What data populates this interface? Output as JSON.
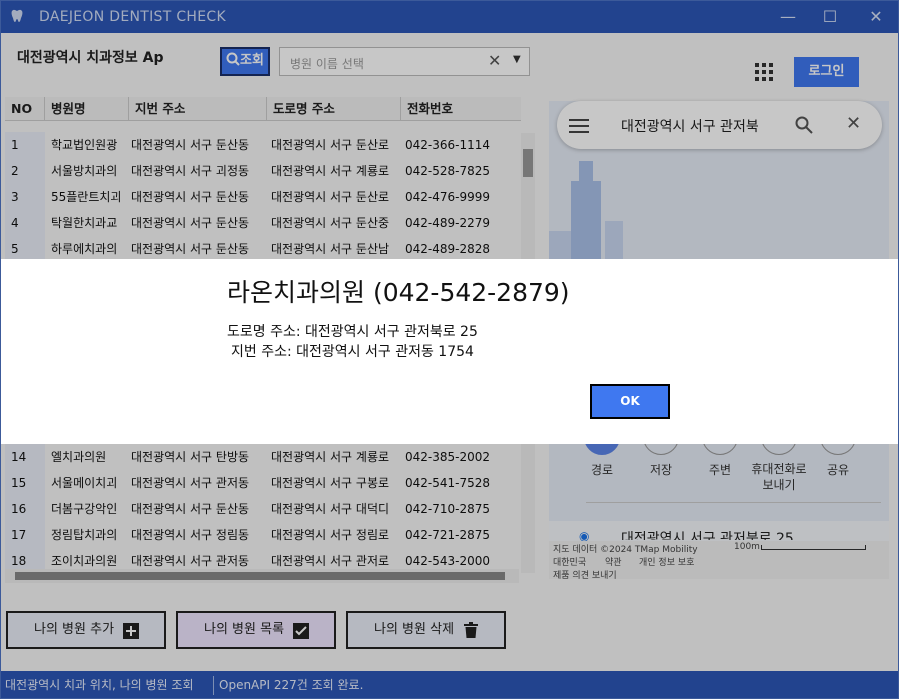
{
  "window": {
    "title": "DAEJEON DENTIST CHECK"
  },
  "header": {
    "title": "대전광역시 치과정보 Ap",
    "search_button": "조회",
    "combo_placeholder": "병원 이름 선택",
    "login_button": "로그인"
  },
  "table": {
    "headers": [
      "NO",
      "병원명",
      "지번 주소",
      "도로명 주소",
      "전화번호"
    ],
    "rows_top": [
      {
        "no": "1",
        "name": "학교법인원광",
        "jibun": "대전광역시 서구 둔산동",
        "road": "대전광역시 서구 둔산로",
        "phone": "042-366-1114"
      },
      {
        "no": "2",
        "name": "서울방치과의",
        "jibun": "대전광역시 서구 괴정동",
        "road": "대전광역시 서구 계룡로",
        "phone": "042-528-7825"
      },
      {
        "no": "3",
        "name": "55플란트치괴",
        "jibun": "대전광역시 서구 둔산동",
        "road": "대전광역시 서구 둔산로",
        "phone": "042-476-9999"
      },
      {
        "no": "4",
        "name": "탁월한치과교",
        "jibun": "대전광역시 서구 둔산동",
        "road": "대전광역시 서구 둔산중",
        "phone": "042-489-2279"
      },
      {
        "no": "5",
        "name": "하루에치과의",
        "jibun": "대전광역시 서구 둔산동",
        "road": "대전광역시 서구 둔산남",
        "phone": "042-489-2828"
      }
    ],
    "rows_bottom": [
      {
        "no": "14",
        "name": "엘치과의원",
        "jibun": "대전광역시 서구 탄방동",
        "road": "대전광역시 서구 계룡로",
        "phone": "042-385-2002"
      },
      {
        "no": "15",
        "name": "서울메이치괴",
        "jibun": "대전광역시 서구 관저동",
        "road": "대전광역시 서구 구봉로",
        "phone": "042-541-7528"
      },
      {
        "no": "16",
        "name": "더봄구강악인",
        "jibun": "대전광역시 서구 둔산동",
        "road": "대전광역시 서구 대덕디",
        "phone": "042-710-2875"
      },
      {
        "no": "17",
        "name": "정림탑치과의",
        "jibun": "대전광역시 서구 정림동",
        "road": "대전광역시 서구 정림로",
        "phone": "042-721-2875"
      },
      {
        "no": "18",
        "name": "조이치과의원",
        "jibun": "대전광역시 서구 관저동",
        "road": "대전광역시 서구 관저로",
        "phone": "042-543-2000"
      }
    ]
  },
  "map": {
    "search_text": "대전광역시 서구 관저북",
    "actions": [
      "경로",
      "저장",
      "주변",
      "휴대전화로\n보내기",
      "공유"
    ],
    "address_hint": "대전광역시 서구 관저북로 25",
    "scale": "100m",
    "copyright": "지도 데이터 ©2024 TMap Mobility",
    "links": [
      "대한민국",
      "약관",
      "개인 정보 보호"
    ],
    "feedback": "제품 의견 보내기"
  },
  "bottom_buttons": {
    "add": "나의 병원 추가",
    "list": "나의 병원 목록",
    "delete": "나의 병원 삭제"
  },
  "status": {
    "left": "대전광역시 치과 위치, 나의 병원 조회",
    "right": "OpenAPI 227건 조회 완료."
  },
  "dialog": {
    "title": "라온치과의원 (042-542-2879)",
    "road_line": "도로명 주소: 대전광역시 서구 관저북로 25",
    "jibun_line": "지번 주소: 대전광역시 서구 관저동 1754",
    "ok": "OK"
  }
}
